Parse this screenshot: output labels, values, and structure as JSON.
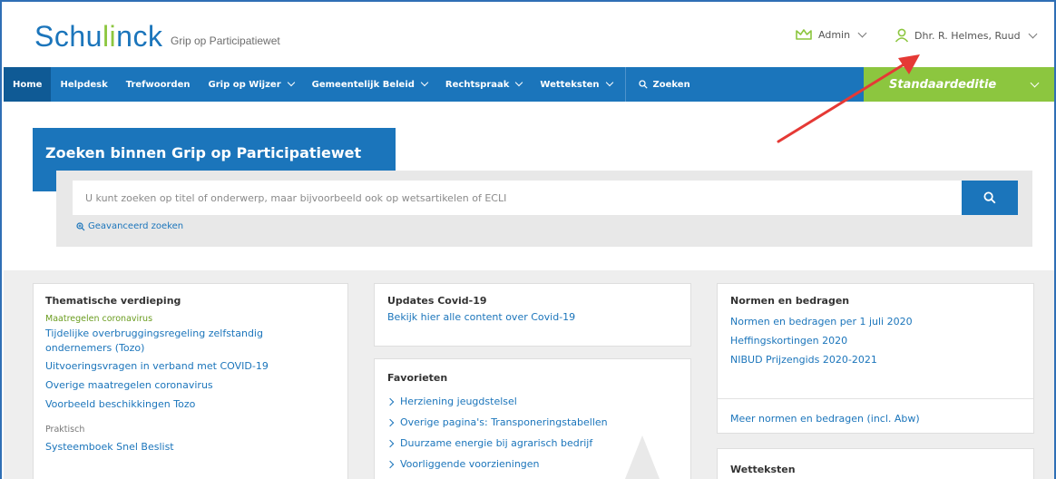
{
  "header": {
    "logo_main": "Schu",
    "logo_accent": "li",
    "logo_rest": "nck",
    "logo_subtitle": "Grip op Participatiewet",
    "admin_label": "Admin",
    "user_label": "Dhr. R. Helmes, Ruud"
  },
  "nav": {
    "items": [
      {
        "label": "Home"
      },
      {
        "label": "Helpdesk"
      },
      {
        "label": "Trefwoorden"
      },
      {
        "label": "Grip op Wijzer"
      },
      {
        "label": "Gemeentelijk Beleid"
      },
      {
        "label": "Rechtspraak"
      },
      {
        "label": "Wetteksten"
      }
    ],
    "search_label": "Zoeken",
    "edition_label": "Standaardeditie"
  },
  "search": {
    "title": "Zoeken binnen Grip op Participatiewet",
    "placeholder": "U kunt zoeken op titel of onderwerp, maar bijvoorbeeld ook op wetsartikelen of ECLI",
    "advanced_label": "Geavanceerd zoeken"
  },
  "thematic": {
    "title": "Thematische verdieping",
    "group1_head": "Maatregelen coronavirus",
    "group1_links": [
      "Tijdelijke overbruggingsregeling zelfstandig ondernemers (Tozo)",
      "Uitvoeringsvragen in verband met COVID-19",
      "Overige maatregelen coronavirus",
      "Voorbeeld beschikkingen Tozo"
    ],
    "group2_head": "Praktisch",
    "group2_first": "Systeemboek Snel Beslist"
  },
  "covid": {
    "title": "Updates Covid-19",
    "link": "Bekijk hier alle content over Covid-19"
  },
  "favorites": {
    "title": "Favorieten",
    "items": [
      "Herziening jeugdstelsel",
      "Overige pagina's: Transponeringstabellen",
      "Duurzame energie bij agrarisch bedrijf",
      "Voorliggende voorzieningen"
    ]
  },
  "norms": {
    "title": "Normen en bedragen",
    "links": [
      "Normen en bedragen per 1 juli 2020",
      "Heffingskortingen 2020",
      "NIBUD Prijzengids 2020-2021"
    ],
    "more": "Meer normen en bedragen (incl. Abw)"
  },
  "laws": {
    "title": "Wetteksten"
  },
  "colors": {
    "brand_blue": "#1b75bb",
    "brand_green": "#8cc63f",
    "annotation_red": "#e53935"
  }
}
